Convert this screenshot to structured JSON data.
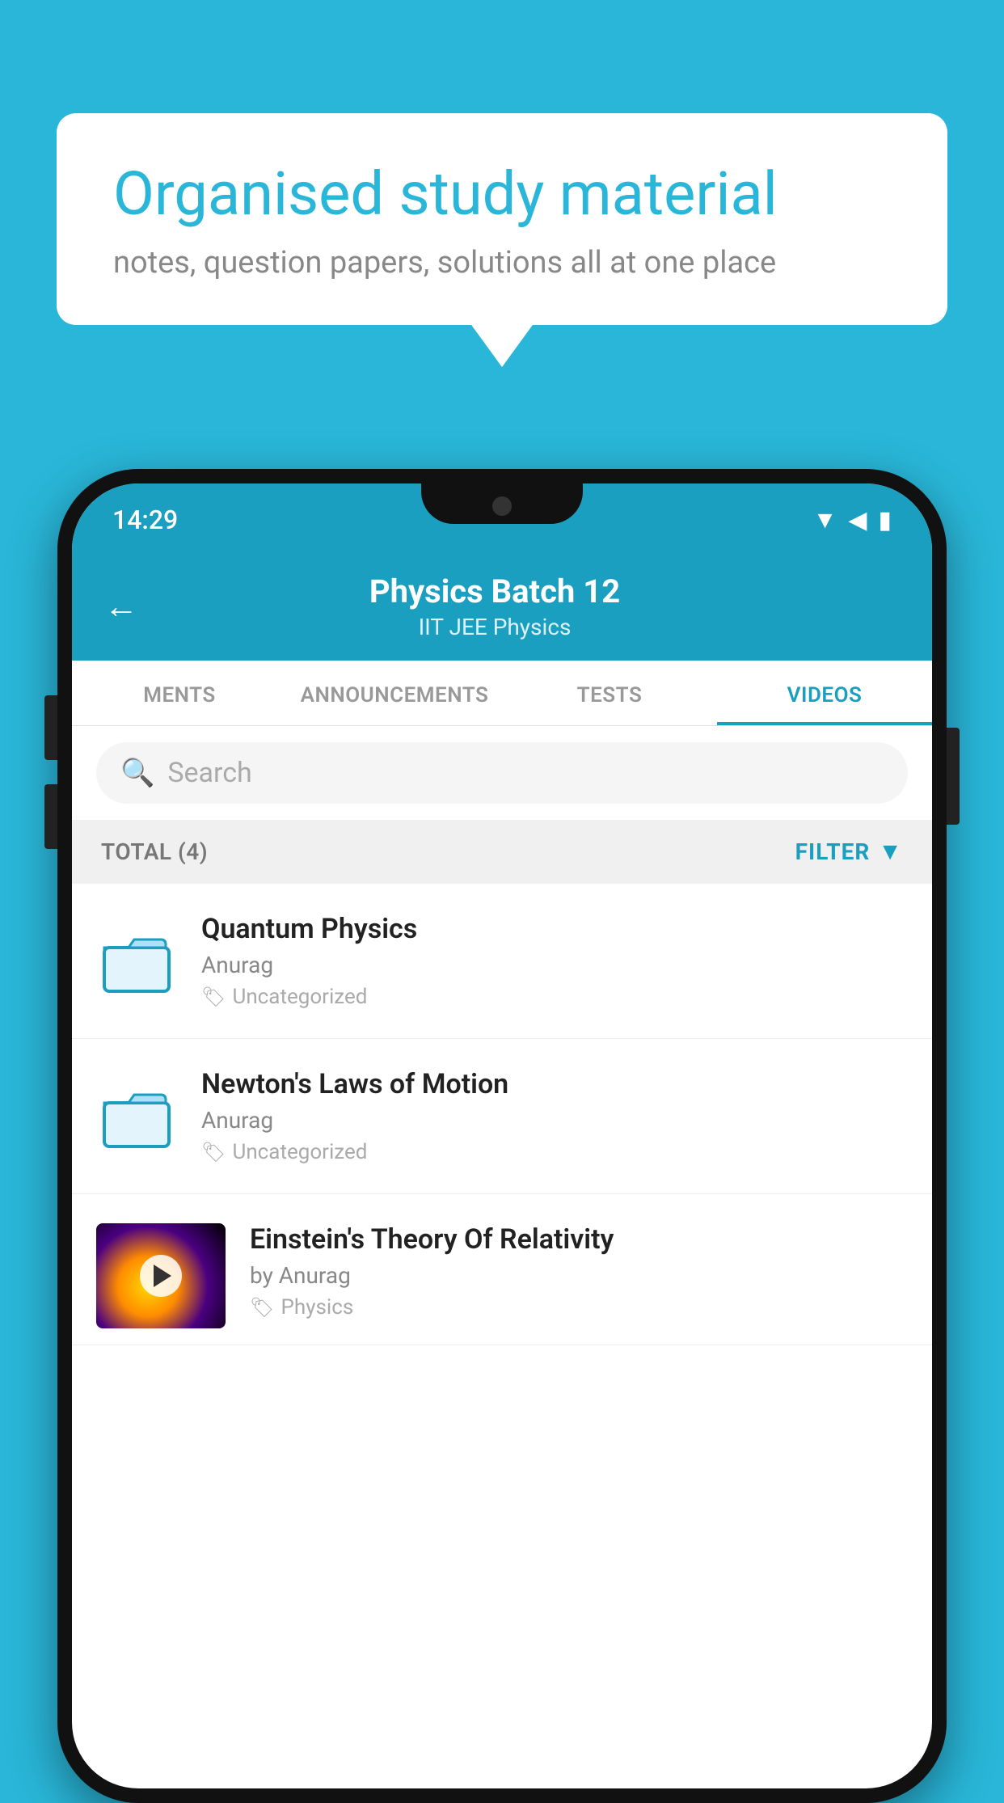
{
  "background_color": "#29b6d8",
  "speech_bubble": {
    "title": "Organised study material",
    "subtitle": "notes, question papers, solutions all at one place"
  },
  "phone": {
    "status_bar": {
      "time": "14:29",
      "icons": [
        "wifi",
        "signal",
        "battery"
      ]
    },
    "header": {
      "back_label": "←",
      "title": "Physics Batch 12",
      "subtitle": "IIT JEE   Physics"
    },
    "tabs": [
      {
        "label": "MENTS",
        "active": false
      },
      {
        "label": "ANNOUNCEMENTS",
        "active": false
      },
      {
        "label": "TESTS",
        "active": false
      },
      {
        "label": "VIDEOS",
        "active": true
      }
    ],
    "search": {
      "placeholder": "Search"
    },
    "filter_bar": {
      "total_label": "TOTAL (4)",
      "filter_label": "FILTER"
    },
    "videos": [
      {
        "id": 1,
        "title": "Quantum Physics",
        "author": "Anurag",
        "tag": "Uncategorized",
        "type": "folder",
        "has_thumbnail": false
      },
      {
        "id": 2,
        "title": "Newton's Laws of Motion",
        "author": "Anurag",
        "tag": "Uncategorized",
        "type": "folder",
        "has_thumbnail": false
      },
      {
        "id": 3,
        "title": "Einstein's Theory Of Relativity",
        "author": "by Anurag",
        "tag": "Physics",
        "type": "video",
        "has_thumbnail": true
      }
    ]
  }
}
